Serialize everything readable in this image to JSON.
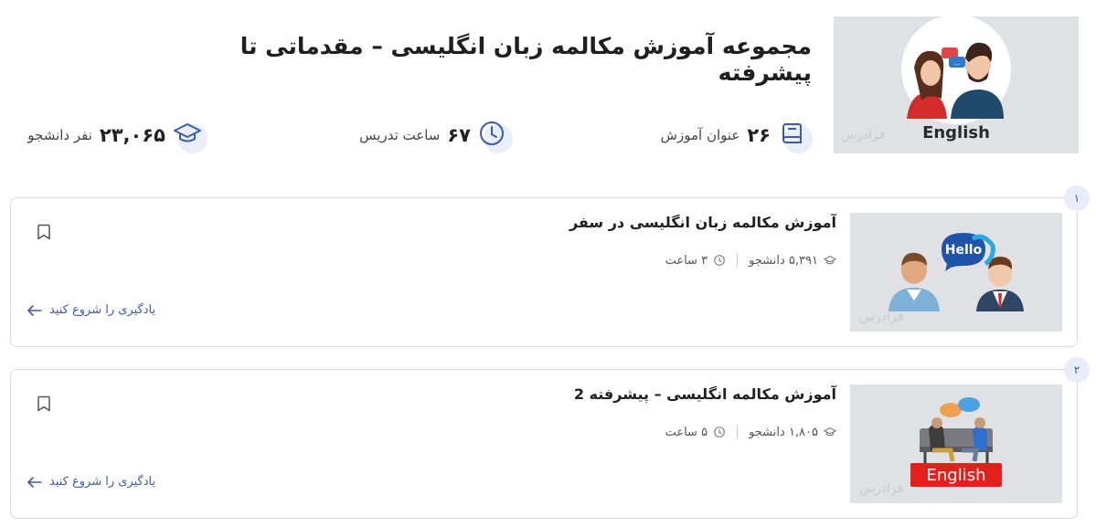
{
  "collection": {
    "title": "مجموعه آموزش مکالمه زبان انگلیسی – مقدماتی تا پیشرفته",
    "thumbnail_caption": "English",
    "watermark": "فرادرس",
    "stats": {
      "courses_value": "۲۶",
      "courses_label": "عنوان آموزش",
      "hours_value": "۶۷",
      "hours_label": "ساعت تدریس",
      "students_value": "۲۳,۰۶۵",
      "students_label": "نفر دانشجو"
    }
  },
  "courses": [
    {
      "index": "۱",
      "title": "آموزش مکالمه زبان انگلیسی در سفر",
      "students": "۵,۳۹۱ دانشجو",
      "duration": "۳ ساعت",
      "start_label": "یادگیری را شروع کنید",
      "thumb_text": "Hello"
    },
    {
      "index": "۲",
      "title": "آموزش مکالمه انگلیسی – پیشرفته 2",
      "students": "۱,۸۰۵ دانشجو",
      "duration": "۵ ساعت",
      "start_label": "یادگیری را شروع کنید",
      "thumb_text": "English"
    }
  ],
  "icons": {
    "courses": "book-icon",
    "hours": "clock-icon",
    "students": "graduation-cap-icon",
    "bookmark": "bookmark-icon",
    "arrow": "arrow-left-icon"
  },
  "colors": {
    "accent": "#3b5bab",
    "english_badge": "#e3201b"
  }
}
